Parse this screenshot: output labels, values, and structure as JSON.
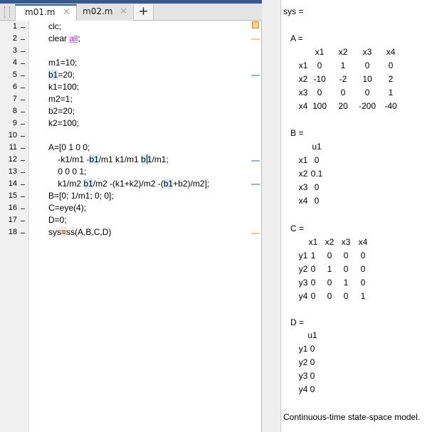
{
  "editor": {
    "tabs": [
      {
        "label": "m01.m",
        "close": "✕"
      },
      {
        "label": "m02.m",
        "close": "✕"
      }
    ],
    "add_tab": "+",
    "line_numbers": [
      "1",
      "2",
      "3",
      "4",
      "5",
      "6",
      "7",
      "8",
      "9",
      "10",
      "11",
      "12",
      "13",
      "14",
      "15",
      "16",
      "17",
      "18"
    ],
    "lines": {
      "l1": "clc;",
      "l2_pre": "clear ",
      "l2_kw": "all",
      "l2_post": ";",
      "l4": "m1=10;",
      "l5_hl": "b1",
      "l5_post": "=20;",
      "l6": "k1=100;",
      "l7": "m2=1;",
      "l8": "b2=20;",
      "l9": "k2=100;",
      "l11": "A=[0 1 0 0;",
      "l12_a": "    -k1/m1 -",
      "l12_hl1": "b1",
      "l12_b": "/m1 k1/m1 ",
      "l12_hl2a": "b",
      "l12_hl2b": "1",
      "l12_c": "/m1;",
      "l13": "    0 0 0 1;",
      "l14_a": "    k1/m2 ",
      "l14_hl1": "b1",
      "l14_b": "/m2 -(k1+k2)/m2 -(",
      "l14_hl2": "b1",
      "l14_c": "+b2)/m2];",
      "l15": "B=[0; 1/m1; 0; 0];",
      "l16": "C=eye(4);",
      "l17": "D=0;",
      "l18_a": "sys",
      "l18_hl": "=",
      "l18_b": "ss(A,B,C,D)"
    }
  },
  "output": {
    "sys_header": "sys =",
    "A": {
      "label": "A =",
      "cols": [
        "x1",
        "x2",
        "x3",
        "x4"
      ],
      "rows": [
        {
          "name": "x1",
          "vals": [
            "0",
            "1",
            "0",
            "0"
          ]
        },
        {
          "name": "x2",
          "vals": [
            "-10",
            "-2",
            "10",
            "2"
          ]
        },
        {
          "name": "x3",
          "vals": [
            "0",
            "0",
            "0",
            "1"
          ]
        },
        {
          "name": "x4",
          "vals": [
            "100",
            "20",
            "-200",
            "-40"
          ]
        }
      ]
    },
    "B": {
      "label": "B =",
      "col": "u1",
      "rows": [
        {
          "name": "x1",
          "val": "0"
        },
        {
          "name": "x2",
          "val": "0.1"
        },
        {
          "name": "x3",
          "val": "0"
        },
        {
          "name": "x4",
          "val": "0"
        }
      ]
    },
    "C": {
      "label": "C =",
      "cols": [
        "x1",
        "x2",
        "x3",
        "x4"
      ],
      "rows": [
        {
          "name": "y1",
          "vals": [
            "1",
            "0",
            "0",
            "0"
          ]
        },
        {
          "name": "y2",
          "vals": [
            "0",
            "1",
            "0",
            "0"
          ]
        },
        {
          "name": "y3",
          "vals": [
            "0",
            "0",
            "1",
            "0"
          ]
        },
        {
          "name": "y4",
          "vals": [
            "0",
            "0",
            "0",
            "1"
          ]
        }
      ]
    },
    "D": {
      "label": "D =",
      "col": "u1",
      "rows": [
        {
          "name": "y1",
          "val": "0"
        },
        {
          "name": "y2",
          "val": "0"
        },
        {
          "name": "y3",
          "val": "0"
        },
        {
          "name": "y4",
          "val": "0"
        }
      ]
    },
    "footer": "Continuous-time state-space model."
  },
  "icons": {
    "warning": "warning-indicator-icon",
    "grip": "drag-grip-icon"
  },
  "colors": {
    "accent": "#3a5a8c",
    "variable_highlight": "#d7ecf3",
    "warning": "#fdd48a",
    "keyword": "#a020f0"
  }
}
